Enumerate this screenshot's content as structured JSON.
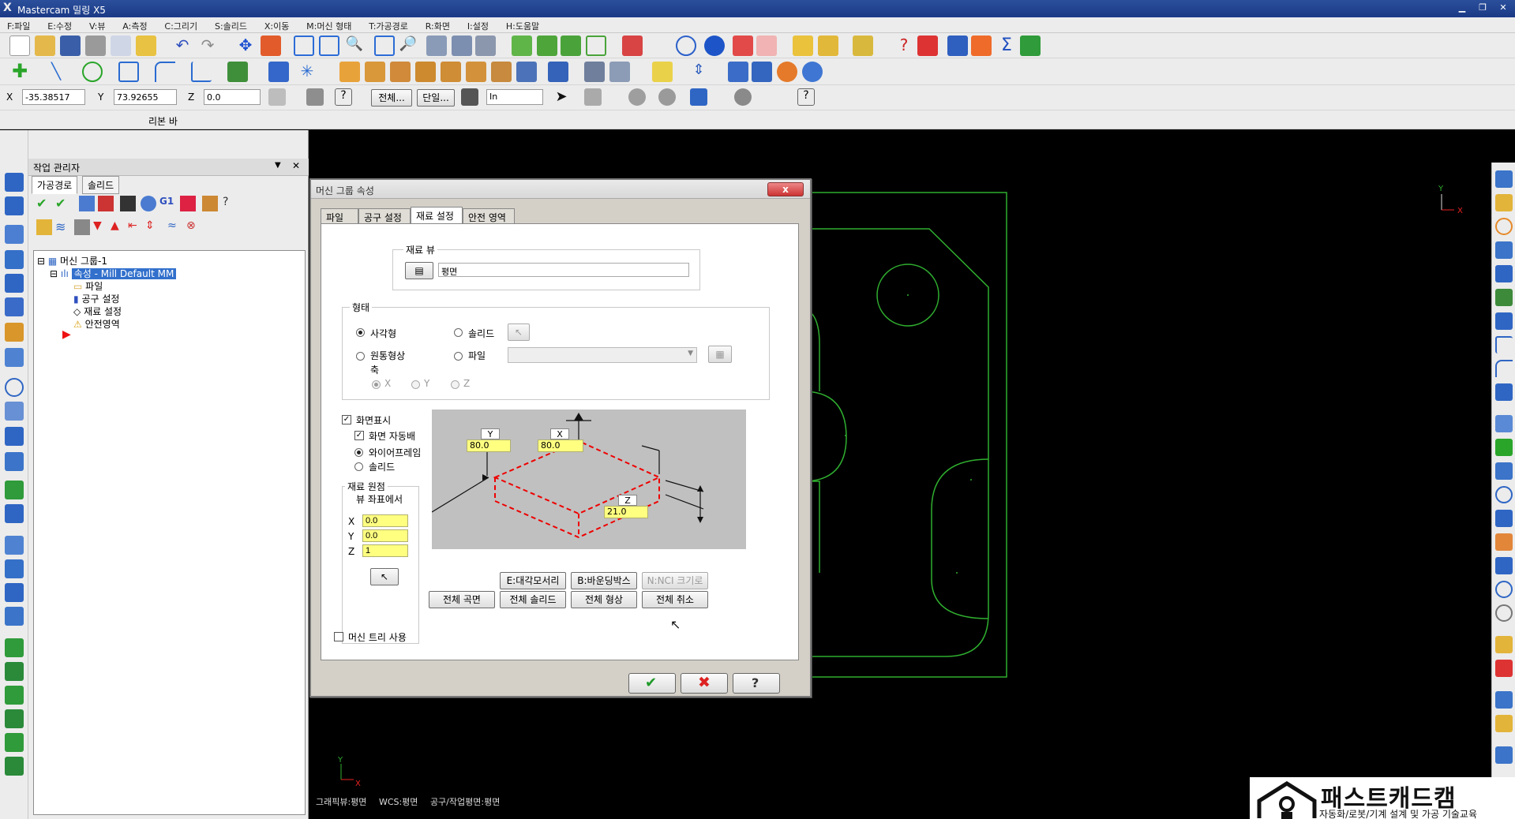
{
  "app": {
    "title": "Mastercam 밀링 X5"
  },
  "menu": [
    "F:파일",
    "E:수정",
    "V:뷰",
    "A:측정",
    "C:그리기",
    "S:솔리드",
    "X:이동",
    "M:머신 형태",
    "T:가공경로",
    "R:화면",
    "I:설정",
    "H:도움말"
  ],
  "coords": {
    "x_label": "X",
    "x": "-35.38517",
    "y_label": "Y",
    "y": "73.92655",
    "z_label": "Z",
    "z": "0.0"
  },
  "toolbar3": {
    "all": "전체...",
    "single": "단일...",
    "mode": "In"
  },
  "ribbon": {
    "label": "리본 바"
  },
  "ops_manager": {
    "title": "작업 관리자",
    "tabs": [
      "가공경로",
      "솔리드"
    ],
    "tree": {
      "root": "머신 그룹-1",
      "props": "속성 - Mill Default MM",
      "files": "파일",
      "tool_settings": "공구 설정",
      "stock_setup": "재료 설정",
      "safety_zone": "안전영역"
    }
  },
  "dialog": {
    "title": "머신 그룹 속성",
    "close": "x",
    "tabs": [
      "파일",
      "공구 설정",
      "재료 설정",
      "안전 영역"
    ],
    "stock_view": {
      "label": "재료 뷰",
      "value": "평면"
    },
    "shape": {
      "label": "형태",
      "rect": "사각형",
      "solid": "솔리드",
      "cyl": "원통형상",
      "file": "파일",
      "axis": "축",
      "ax_x": "X",
      "ax_y": "Y",
      "ax_z": "Z"
    },
    "display": {
      "label": "화면표시",
      "fit": "화면 자동배",
      "wire": "와이어프레임",
      "solid": "솔리드"
    },
    "origin": {
      "label": "재료 원점",
      "sub": "뷰 좌표에서",
      "x_label": "X",
      "x": "0.0",
      "y_label": "Y",
      "y": "0.0",
      "z_label": "Z",
      "z": "1"
    },
    "preview": {
      "y_tag": "Y",
      "x_tag": "X",
      "z_tag": "Z",
      "y": "80.0",
      "x": "80.0",
      "z": "21.0"
    },
    "buttons": {
      "corners": "E:대각모서리",
      "bbox": "B:바운딩박스",
      "nci": "N:NCI 크기로",
      "all_surfaces": "전체 곡면",
      "all_solids": "전체 솔리드",
      "all_entities": "전체 형상",
      "all_cancel": "전체 취소"
    },
    "machine_tree": "머신 트리 사용"
  },
  "status": {
    "gview": "그래픽뷰:평면",
    "wcs": "WCS:평면",
    "tplane": "공구/작업평면:평면"
  },
  "logo": {
    "brand": "패스트캐드캠",
    "tagline": "자동화/로봇/기계 설계 및 가공 기술교육"
  },
  "colors": {
    "title_blue": "#1b3a86",
    "geometry_green": "#2fae2f",
    "selection": "#3270cc",
    "field_yellow": "#ffff80"
  }
}
